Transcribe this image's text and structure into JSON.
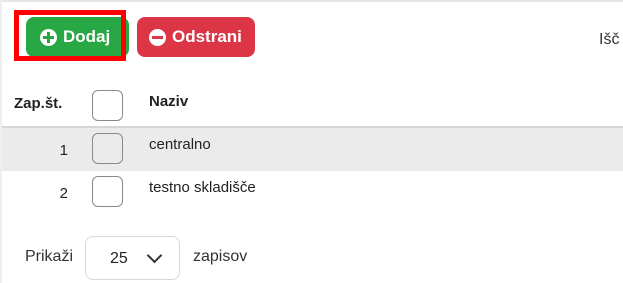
{
  "toolbar": {
    "add_label": "Dodaj",
    "remove_label": "Odstrani",
    "add_icon": "plus-circle-icon",
    "remove_icon": "minus-circle-icon",
    "add_color": "#28a745",
    "remove_color": "#dc3545",
    "highlight_color": "#ff0000",
    "search_label": "Išč"
  },
  "table": {
    "headers": {
      "number": "Zap.št.",
      "name": "Naziv"
    },
    "rows": [
      {
        "number": "1",
        "name": "centralno",
        "checked": false
      },
      {
        "number": "2",
        "name": "testno skladišče",
        "checked": false
      }
    ]
  },
  "footer": {
    "show_label": "Prikaži",
    "page_size": "25",
    "records_label": "zapisov"
  }
}
